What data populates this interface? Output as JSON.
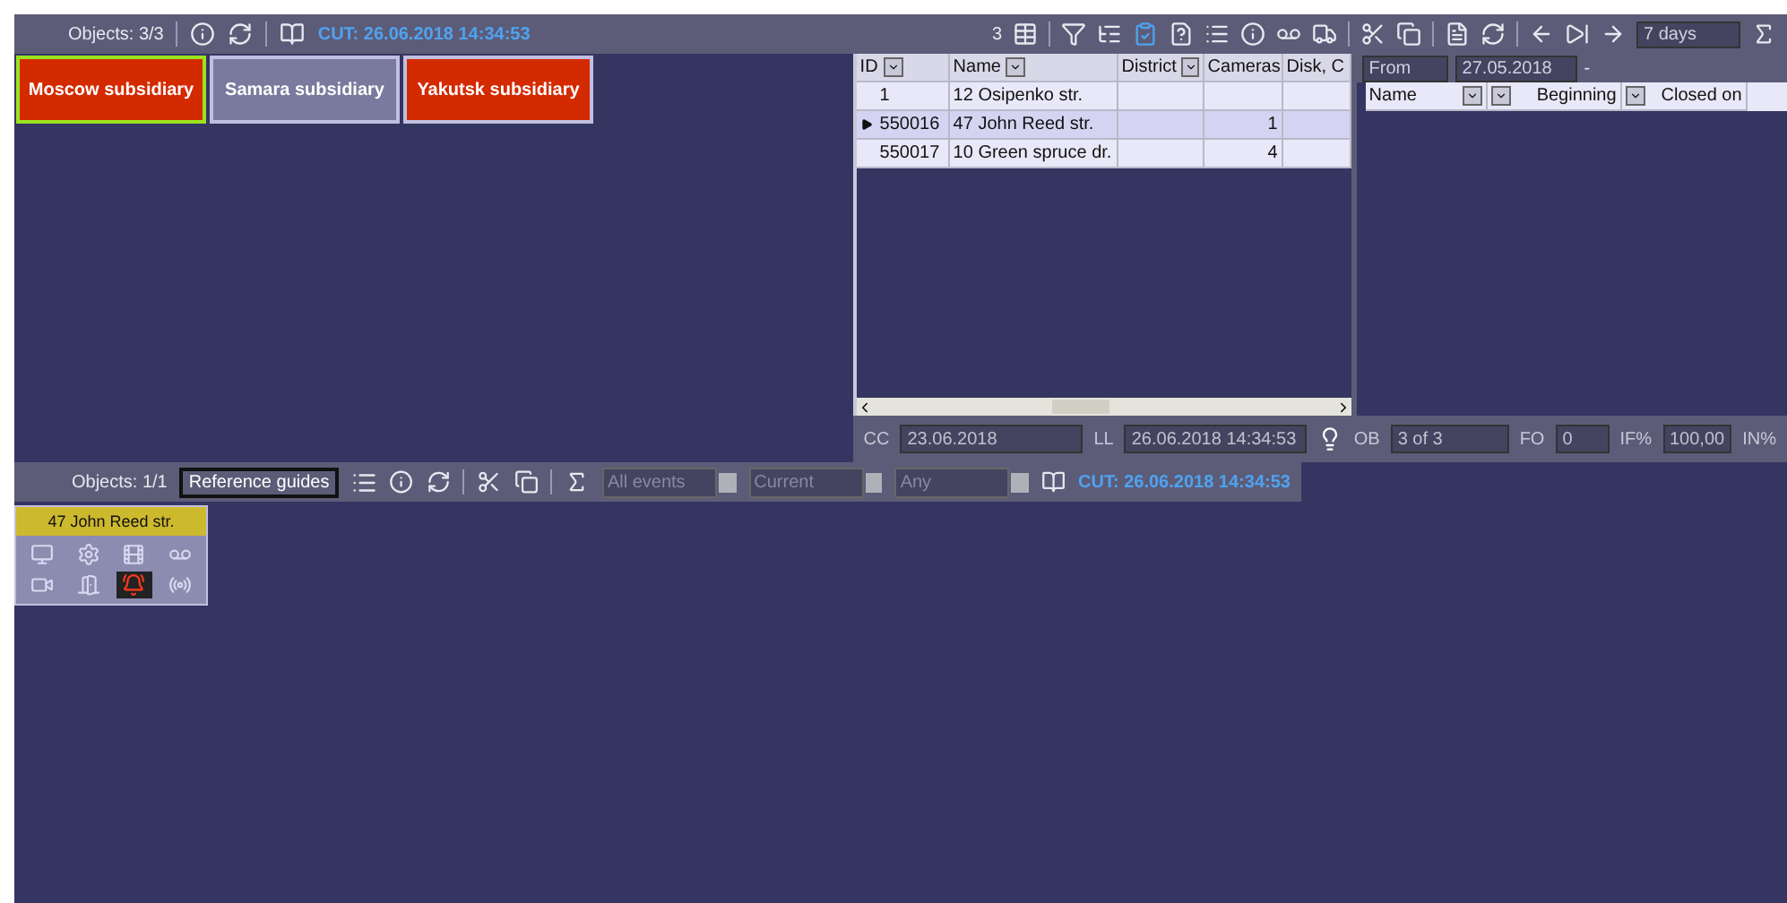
{
  "top_left": {
    "objects_label": "Objects: 3/3",
    "cut_label": "CUT: 26.06.2018 14:34:53",
    "tiles": [
      {
        "label": "Moscow subsidiary",
        "color": "#d42a00",
        "selected": true
      },
      {
        "label": "Samara subsidiary",
        "color": "#7a7a9e",
        "selected": false
      },
      {
        "label": "Yakutsk subsidiary",
        "color": "#d42a00",
        "selected": false
      }
    ]
  },
  "top_right": {
    "count": "3",
    "period": "7 days",
    "table": {
      "columns": [
        "ID",
        "Name",
        "District",
        "Cameras",
        "Disk, C"
      ],
      "rows": [
        {
          "cells": [
            "1",
            "12 Osipenko str.",
            "",
            "",
            ""
          ],
          "selected": false
        },
        {
          "cells": [
            "550016",
            "47 John Reed str.",
            "",
            "1",
            ""
          ],
          "selected": true
        },
        {
          "cells": [
            "550017",
            "10 Green spruce dr.",
            "",
            "4",
            ""
          ],
          "selected": false
        }
      ]
    },
    "events": {
      "from_label": "From",
      "from_date": "27.05.2018",
      "dash": "-",
      "columns": [
        "Name",
        "Beginning",
        "Closed on"
      ]
    },
    "status": [
      {
        "label": "CC",
        "value": "23.06.2018"
      },
      {
        "label": "LL",
        "value": "26.06.2018 14:34:53"
      },
      {
        "label": "OB",
        "value": "3 of 3"
      },
      {
        "label": "FO",
        "value": "0"
      },
      {
        "label": "IF%",
        "value": "100,00"
      }
    ],
    "status_tail": "IN%"
  },
  "bottom": {
    "objects_label": "Objects: 1/1",
    "guides_button": "Reference guides",
    "filters": [
      {
        "placeholder": "All events"
      },
      {
        "placeholder": "Current"
      },
      {
        "placeholder": "Any"
      }
    ],
    "cut_label": "CUT: 26.06.2018 14:34:53",
    "card": {
      "title": "47 John Reed str.",
      "icons": [
        {
          "kind": "computer",
          "active": false
        },
        {
          "kind": "gear",
          "active": false
        },
        {
          "kind": "film",
          "active": false
        },
        {
          "kind": "tape",
          "active": false
        },
        {
          "kind": "camera",
          "active": false
        },
        {
          "kind": "door",
          "active": false
        },
        {
          "kind": "alarm",
          "active": true
        },
        {
          "kind": "signal",
          "active": false
        }
      ]
    }
  }
}
